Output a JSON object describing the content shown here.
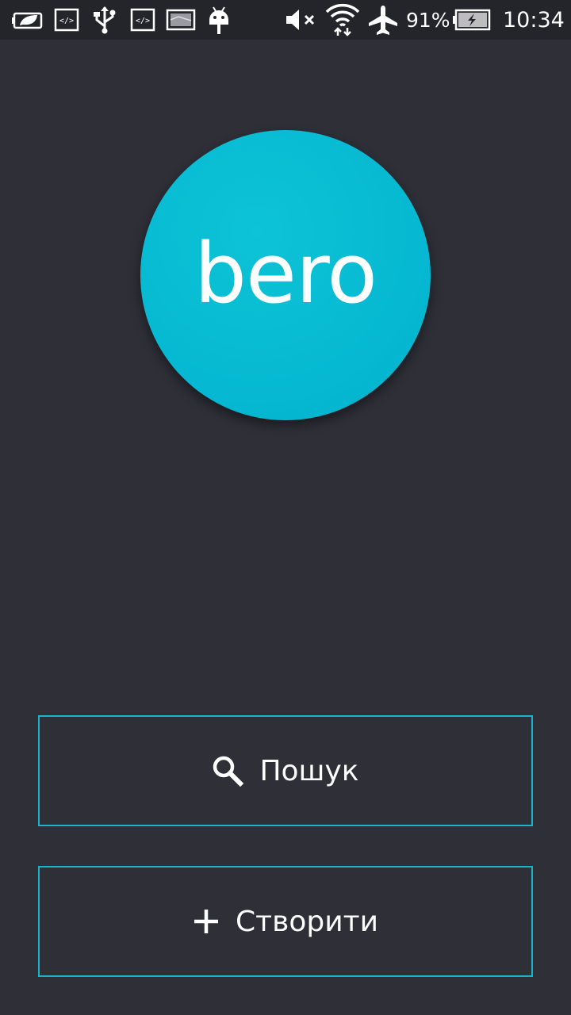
{
  "status_bar": {
    "battery_percent": "91%",
    "clock": "10:34",
    "icons": [
      "battery-saver-icon",
      "developer-code-icon",
      "usb-icon",
      "developer-code-icon",
      "screenshot-image-icon",
      "android-debug-icon",
      "volume-muted-icon",
      "wifi-data-icon",
      "airplane-mode-icon",
      "battery-charging-icon"
    ]
  },
  "logo": {
    "text": "bero",
    "color": "#06b9d2"
  },
  "actions": {
    "search": {
      "icon": "search-icon",
      "label": "Пошук"
    },
    "create": {
      "icon": "plus-icon",
      "label": "Створити"
    }
  },
  "colors": {
    "background": "#2e2f37",
    "status_bar": "#24252b",
    "accent_border": "#19b4cc",
    "text": "#ffffff"
  }
}
